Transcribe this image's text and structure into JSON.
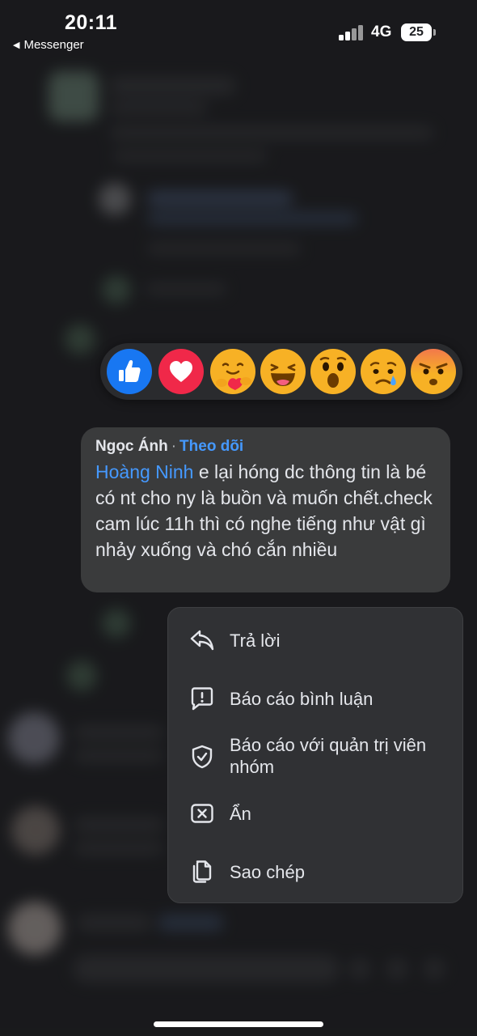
{
  "status_bar": {
    "time": "20:11",
    "back_label": "Messenger",
    "network": "4G",
    "battery": "25"
  },
  "reactions": [
    {
      "name": "like",
      "icon": "thumbs-up-icon",
      "color": "#1877f2"
    },
    {
      "name": "love",
      "icon": "heart-icon",
      "color": "#f02849"
    },
    {
      "name": "care",
      "icon": "hug-face-icon",
      "color": "#f7b125"
    },
    {
      "name": "haha",
      "icon": "laughing-face-icon",
      "color": "#f7b125"
    },
    {
      "name": "wow",
      "icon": "surprised-face-icon",
      "color": "#f7b125"
    },
    {
      "name": "sad",
      "icon": "crying-face-icon",
      "color": "#f7b125"
    },
    {
      "name": "angry",
      "icon": "angry-face-icon",
      "color": "#f59a3a"
    }
  ],
  "comment": {
    "author": "Ngọc Ánh",
    "separator": "·",
    "follow_label": "Theo dõi",
    "mention": "Hoàng Ninh",
    "text": " e lại hóng dc thông tin là bé có nt cho ny là buồn và muốn chết.check cam lúc 11h thì có nghe tiếng như vật gì nhảy xuống và chó cắn nhiều"
  },
  "menu": {
    "items": [
      {
        "label": "Trả lời",
        "icon": "reply-arrow-icon"
      },
      {
        "label": "Báo cáo bình luận",
        "icon": "report-comment-icon"
      },
      {
        "label": "Báo cáo với quản trị viên nhóm",
        "icon": "shield-check-icon"
      },
      {
        "label": "Ẩn",
        "icon": "hide-x-icon"
      },
      {
        "label": "Sao chép",
        "icon": "copy-icon"
      }
    ]
  },
  "colors": {
    "accent_link": "#4599ff",
    "background": "#1f2023",
    "bubble": "#3a3b3c",
    "menu": "#303134"
  }
}
